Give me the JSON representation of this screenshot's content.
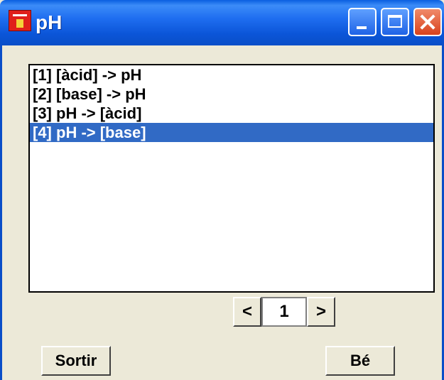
{
  "window": {
    "title": "pH",
    "app_icon": "app-logo-icon",
    "controls": {
      "minimize": "minimize-icon",
      "maximize": "maximize-icon",
      "close": "close-icon"
    }
  },
  "list": {
    "items": [
      "[1] [àcid] -> pH",
      "[2] [base] -> pH",
      "[3] pH -> [àcid]",
      "[4] pH -> [base]"
    ],
    "selected_index": 3
  },
  "pager": {
    "prev_label": "<",
    "value": "1",
    "next_label": ">"
  },
  "buttons": {
    "exit_label": "Sortir",
    "ok_label": "Bé"
  },
  "colors": {
    "titlebar": "#0a5fe0",
    "selection": "#316ac5",
    "background": "#ece9d8"
  }
}
